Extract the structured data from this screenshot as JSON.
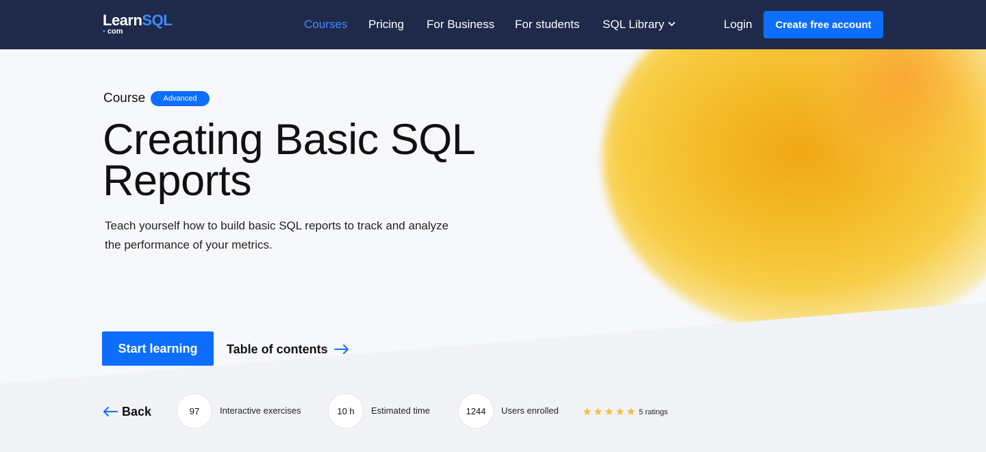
{
  "nav": {
    "logo_main": "Learn",
    "logo_accent": "SQL",
    "logo_sub": "com",
    "links": [
      "Courses",
      "Pricing",
      "For Business",
      "For students",
      "SQL Library"
    ],
    "login": "Login",
    "create_account": "Create free account",
    "active_color": "#3d8bff",
    "bg_color": "#1f2a4a"
  },
  "hero": {
    "eyebrow": "Course",
    "badge": "Advanced",
    "title": "Creating Basic SQL Reports",
    "subtitle": "Teach yourself how to build basic SQL reports to track and analyze the performance of your metrics.",
    "start_button": "Start learning",
    "toc_link": "Table of contents"
  },
  "stats": {
    "back": "Back",
    "exercises_value": "97",
    "exercises_label": "Interactive exercises",
    "time_value": "10 h",
    "time_label": "Estimated time",
    "users_value": "1244",
    "users_label": "Users enrolled",
    "stars": 5,
    "ratings_label": "5 ratings"
  },
  "colors": {
    "primary": "#0d6efd",
    "star": "#f6c24a"
  }
}
